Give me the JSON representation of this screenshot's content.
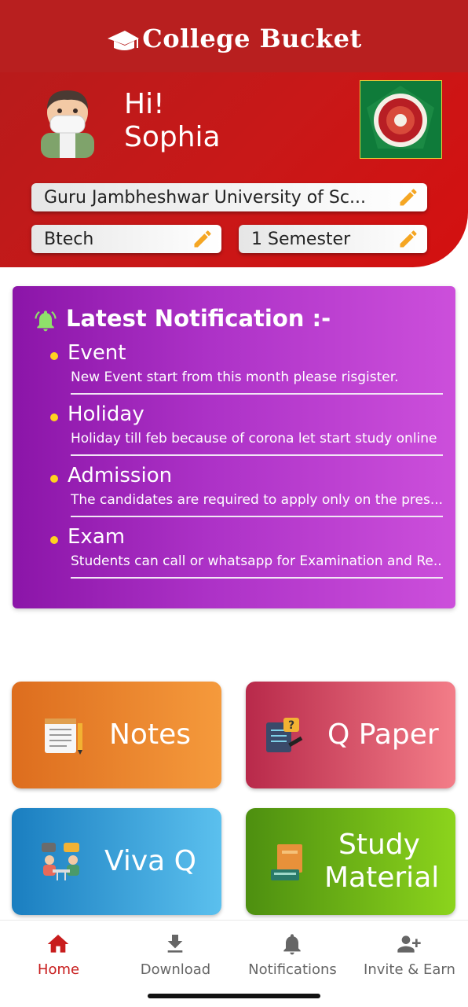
{
  "app": {
    "title": "College Bucket"
  },
  "profile": {
    "greeting": "Hi!",
    "name": "Sophia"
  },
  "fields": {
    "university": "Guru Jambheshwar University of Sc...",
    "course": "Btech",
    "semester": "1 Semester"
  },
  "notifications": {
    "title": "Latest Notification :-",
    "items": [
      {
        "title": "Event",
        "desc": "New Event start from this month please risgister."
      },
      {
        "title": "Holiday",
        "desc": "Holiday till feb because of corona let start study online"
      },
      {
        "title": "Admission",
        "desc": "The candidates are required to apply only on the pres..."
      },
      {
        "title": "Exam",
        "desc": "Students can call or whatsapp for Examination and Re..."
      }
    ]
  },
  "tiles": [
    {
      "label": "Notes",
      "icon": "notepad-icon",
      "colors": [
        "#dd6d1e",
        "#f59a3c"
      ]
    },
    {
      "label": "Q Paper",
      "icon": "question-paper-icon",
      "colors": [
        "#b8294a",
        "#f37d88"
      ]
    },
    {
      "label": "Viva Q",
      "icon": "viva-discussion-icon",
      "colors": [
        "#1a7ec0",
        "#5bc0ee"
      ]
    },
    {
      "label_line1": "Study",
      "label_line2": "Material",
      "icon": "books-icon",
      "colors": [
        "#4d8f10",
        "#8cd41c"
      ]
    }
  ],
  "nav": [
    {
      "label": "Home",
      "icon": "home-icon",
      "active": true
    },
    {
      "label": "Download",
      "icon": "download-icon",
      "active": false
    },
    {
      "label": "Notifications",
      "icon": "bell-icon",
      "active": false
    },
    {
      "label": "Invite & Earn",
      "icon": "add-person-icon",
      "active": false
    }
  ],
  "colors": {
    "primary": "#c81d1d",
    "accent": "#ffd21f",
    "pencil": "#f5a623"
  }
}
